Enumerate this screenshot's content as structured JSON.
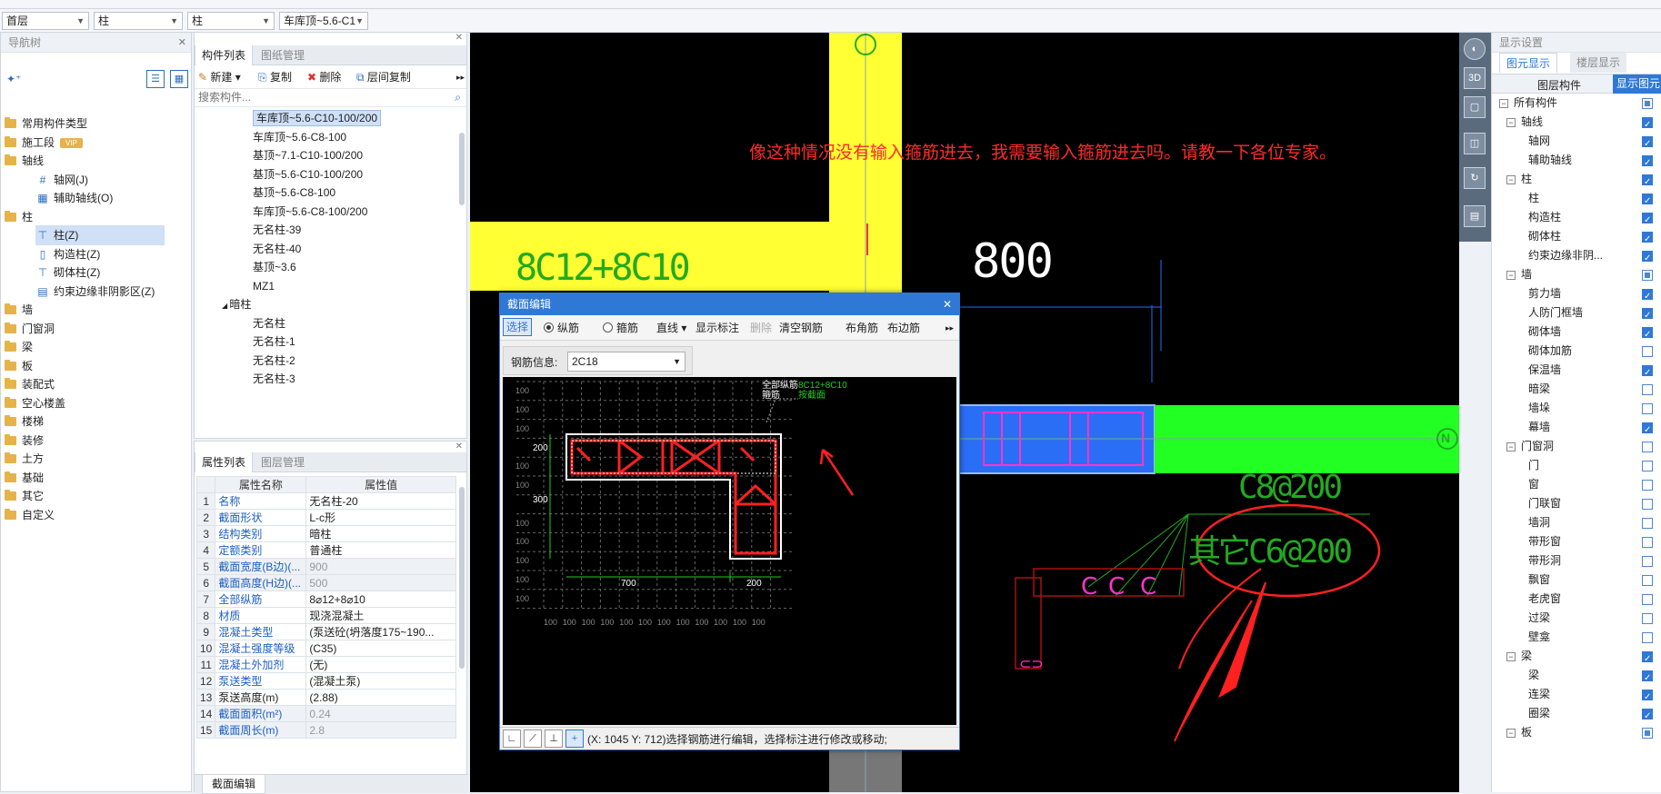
{
  "top_selectors": [
    {
      "value": "首层"
    },
    {
      "value": "柱"
    },
    {
      "value": "柱"
    },
    {
      "value": "车库顶~5.6-C1"
    }
  ],
  "nav": {
    "title": "导航树",
    "items": [
      {
        "label": "常用构件类型",
        "level": 0
      },
      {
        "label": "施工段",
        "level": 0,
        "badge": "VIP"
      },
      {
        "label": "轴线",
        "level": 0
      },
      {
        "label": "轴网(J)",
        "level": 1
      },
      {
        "label": "辅助轴线(O)",
        "level": 1
      },
      {
        "label": "柱",
        "level": 0
      },
      {
        "label": "柱(Z)",
        "level": 1,
        "selected": true
      },
      {
        "label": "构造柱(Z)",
        "level": 1
      },
      {
        "label": "砌体柱(Z)",
        "level": 1
      },
      {
        "label": "约束边缘非阴影区(Z)",
        "level": 1
      },
      {
        "label": "墙",
        "level": 0
      },
      {
        "label": "门窗洞",
        "level": 0
      },
      {
        "label": "梁",
        "level": 0
      },
      {
        "label": "板",
        "level": 0
      },
      {
        "label": "装配式",
        "level": 0
      },
      {
        "label": "空心楼盖",
        "level": 0
      },
      {
        "label": "楼梯",
        "level": 0
      },
      {
        "label": "装修",
        "level": 0
      },
      {
        "label": "土方",
        "level": 0
      },
      {
        "label": "基础",
        "level": 0
      },
      {
        "label": "其它",
        "level": 0
      },
      {
        "label": "自定义",
        "level": 0
      }
    ]
  },
  "component_list": {
    "tabs": [
      "构件列表",
      "图纸管理"
    ],
    "toolbar": {
      "new": "新建",
      "copy": "复制",
      "delete": "删除",
      "floor_copy": "层间复制"
    },
    "search_placeholder": "搜索构件...",
    "items": [
      {
        "label": "车库顶~5.6-C10-100/200",
        "selected": true
      },
      {
        "label": "车库顶~5.6-C8-100"
      },
      {
        "label": "基顶~7.1-C10-100/200"
      },
      {
        "label": "基顶~5.6-C10-100/200"
      },
      {
        "label": "基顶~5.6-C8-100"
      },
      {
        "label": "车库顶~5.6-C8-100/200"
      },
      {
        "label": "无名柱-39"
      },
      {
        "label": "无名柱-40"
      },
      {
        "label": "基顶~3.6"
      },
      {
        "label": "MZ1"
      },
      {
        "label": "暗柱",
        "group": true
      },
      {
        "label": "无名柱"
      },
      {
        "label": "无名柱-1"
      },
      {
        "label": "无名柱-2"
      },
      {
        "label": "无名柱-3"
      }
    ]
  },
  "properties": {
    "tabs": [
      "属性列表",
      "图层管理"
    ],
    "headers": [
      "属性名称",
      "属性值"
    ],
    "rows": [
      {
        "n": "1",
        "name": "名称",
        "value": "无名柱-20",
        "blue": true
      },
      {
        "n": "2",
        "name": "截面形状",
        "value": "L-c形",
        "blue": true
      },
      {
        "n": "3",
        "name": "结构类别",
        "value": "暗柱",
        "blue": true
      },
      {
        "n": "4",
        "name": "定额类别",
        "value": "普通柱",
        "blue": true
      },
      {
        "n": "5",
        "name": "截面宽度(B边)(...",
        "value": "900",
        "blue": true,
        "gray": true
      },
      {
        "n": "6",
        "name": "截面高度(H边)(...",
        "value": "500",
        "blue": true,
        "gray": true
      },
      {
        "n": "7",
        "name": "全部纵筋",
        "value": "8⌀12+8⌀10",
        "blue": true
      },
      {
        "n": "8",
        "name": "材质",
        "value": "现浇混凝土",
        "blue": true
      },
      {
        "n": "9",
        "name": "混凝土类型",
        "value": "(泵送砼(坍落度175~190...",
        "blue": true
      },
      {
        "n": "10",
        "name": "混凝土强度等级",
        "value": "(C35)",
        "blue": true
      },
      {
        "n": "11",
        "name": "混凝土外加剂",
        "value": "(无)",
        "blue": true
      },
      {
        "n": "12",
        "name": "泵送类型",
        "value": "(混凝土泵)",
        "blue": true
      },
      {
        "n": "13",
        "name": "泵送高度(m)",
        "value": "(2.88)",
        "blue": false
      },
      {
        "n": "14",
        "name": "截面面积(m²)",
        "value": "0.24",
        "blue": true,
        "gray": true
      },
      {
        "n": "15",
        "name": "截面周长(m)",
        "value": "2.8",
        "blue": true,
        "gray": true
      }
    ],
    "bottom_tab": "截面编辑"
  },
  "cad": {
    "question": "像这种情况没有输入箍筋进去，我需要输入箍筋进去吗。请教一下各位专家。",
    "label_rebar": "8C12+8C10",
    "label_800": "800",
    "label_c8": "C8@200",
    "label_other": "其它C6@200",
    "axis_n": "N",
    "colors": {
      "yellow": "#ffff33",
      "green": "#22ff22",
      "blue": "#2a6ef5",
      "red": "#ff2020"
    }
  },
  "dialog": {
    "title": "截面编辑",
    "toolbar": {
      "select": "选择",
      "radio_long": "纵筋",
      "radio_stirrup": "箍筋",
      "line": "直线",
      "show_mark": "显示标注",
      "delete": "删除",
      "clear": "清空钢筋",
      "corner": "布角筋",
      "edge": "布边筋"
    },
    "rebar_info_label": "钢筋信息:",
    "rebar_info_value": "2C18",
    "drawing": {
      "label_all": "全部纵筋",
      "label_stirrup": "箍筋",
      "value_all": "8C12+8C10",
      "value_stirrup": "按截面",
      "dim_200_left": "200",
      "dim_300": "300",
      "dim_700": "700",
      "dim_200_bottom": "200",
      "grid_left": "100",
      "grid_bottom": "100"
    },
    "status": "(X: 1045 Y: 712)选择钢筋进行编辑，选择标注进行修改或移动;"
  },
  "display": {
    "title": "显示设置",
    "tabs": [
      "图元显示",
      "楼层显示"
    ],
    "headers": [
      "图层构件",
      "显示图元"
    ],
    "rows": [
      {
        "label": "所有构件",
        "level": 0,
        "state": "half",
        "toggle": true
      },
      {
        "label": "轴线",
        "level": 1,
        "state": "on",
        "toggle": true
      },
      {
        "label": "轴网",
        "level": 2,
        "state": "on"
      },
      {
        "label": "辅助轴线",
        "level": 2,
        "state": "on"
      },
      {
        "label": "柱",
        "level": 1,
        "state": "on",
        "toggle": true
      },
      {
        "label": "柱",
        "level": 2,
        "state": "on"
      },
      {
        "label": "构造柱",
        "level": 2,
        "state": "on"
      },
      {
        "label": "砌体柱",
        "level": 2,
        "state": "on"
      },
      {
        "label": "约束边缘非阴...",
        "level": 2,
        "state": "on"
      },
      {
        "label": "墙",
        "level": 1,
        "state": "half",
        "toggle": true
      },
      {
        "label": "剪力墙",
        "level": 2,
        "state": "on"
      },
      {
        "label": "人防门框墙",
        "level": 2,
        "state": "on"
      },
      {
        "label": "砌体墙",
        "level": 2,
        "state": "on"
      },
      {
        "label": "砌体加筋",
        "level": 2,
        "state": "off"
      },
      {
        "label": "保温墙",
        "level": 2,
        "state": "on"
      },
      {
        "label": "暗梁",
        "level": 2,
        "state": "off"
      },
      {
        "label": "墙垛",
        "level": 2,
        "state": "off"
      },
      {
        "label": "幕墙",
        "level": 2,
        "state": "on"
      },
      {
        "label": "门窗洞",
        "level": 1,
        "state": "off",
        "toggle": true
      },
      {
        "label": "门",
        "level": 2,
        "state": "off"
      },
      {
        "label": "窗",
        "level": 2,
        "state": "off"
      },
      {
        "label": "门联窗",
        "level": 2,
        "state": "off"
      },
      {
        "label": "墙洞",
        "level": 2,
        "state": "off"
      },
      {
        "label": "带形窗",
        "level": 2,
        "state": "off"
      },
      {
        "label": "带形洞",
        "level": 2,
        "state": "off"
      },
      {
        "label": "飘窗",
        "level": 2,
        "state": "off"
      },
      {
        "label": "老虎窗",
        "level": 2,
        "state": "off"
      },
      {
        "label": "过梁",
        "level": 2,
        "state": "off"
      },
      {
        "label": "壁龛",
        "level": 2,
        "state": "off"
      },
      {
        "label": "梁",
        "level": 1,
        "state": "on",
        "toggle": true
      },
      {
        "label": "梁",
        "level": 2,
        "state": "on"
      },
      {
        "label": "连梁",
        "level": 2,
        "state": "on"
      },
      {
        "label": "圈梁",
        "level": 2,
        "state": "on"
      },
      {
        "label": "板",
        "level": 1,
        "state": "half",
        "toggle": true
      }
    ]
  }
}
